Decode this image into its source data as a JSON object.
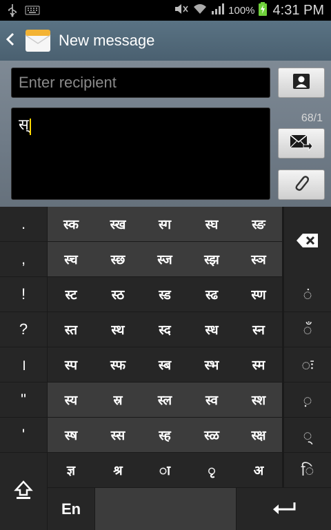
{
  "status_bar": {
    "battery": "100%",
    "time": "4:31 PM",
    "icons": [
      "usb-icon",
      "keyboard-icon",
      "mute-icon",
      "wifi-icon",
      "signal-icon",
      "battery-charging-icon"
    ]
  },
  "action_bar": {
    "title": "New message",
    "back_icon": "chevron-left-icon",
    "app_icon": "envelope-icon"
  },
  "compose": {
    "recipient_placeholder": "Enter recipient",
    "message_text": "स्",
    "counter": "68/1",
    "contact_icon": "contact-icon",
    "send_icon": "send-icon",
    "attach_icon": "paperclip-icon"
  },
  "keyboard": {
    "punctuation": [
      ".",
      ",",
      "!",
      "?",
      "।",
      "\"",
      "'"
    ],
    "consonant_rows": [
      [
        "स्क",
        "स्ख",
        "स्ग",
        "स्घ",
        "स्ङ"
      ],
      [
        "स्च",
        "स्छ",
        "स्ज",
        "स्झ",
        "स्ञ"
      ],
      [
        "स्ट",
        "स्ठ",
        "स्ड",
        "स्ढ",
        "स्ण"
      ],
      [
        "स्त",
        "स्थ",
        "स्द",
        "स्ध",
        "स्न"
      ],
      [
        "स्प",
        "स्फ",
        "स्ब",
        "स्भ",
        "स्म"
      ],
      [
        "स्य",
        "स्र",
        "स्ल",
        "स्व",
        "स्श"
      ],
      [
        "स्ष",
        "स्स",
        "स्ह",
        "स्ळ",
        "स्क्ष"
      ],
      [
        "ज्ञ",
        "श्र",
        "ा",
        "ृ",
        "अ"
      ]
    ],
    "matras": [
      "ं",
      "ँ",
      "ः",
      "़",
      "्",
      "ि"
    ],
    "language_label": "En",
    "backspace_icon": "backspace-icon",
    "shift_icon": "shift-icon",
    "enter_icon": "enter-icon",
    "colors": {
      "dark": "#262626",
      "light": "#3c3c3c",
      "divider": "#111111"
    }
  }
}
